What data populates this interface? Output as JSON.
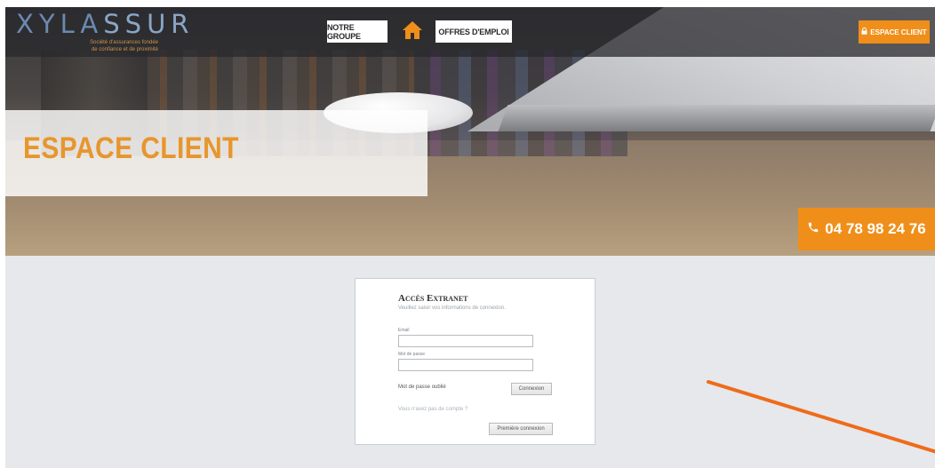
{
  "header": {
    "logo_prefix": "XYLA",
    "logo_suffix": "SSUR",
    "tagline_line1": "Société d'assurances fondée",
    "tagline_line2": "de confiance et de proximité",
    "nav": {
      "notre_groupe": "NOTRE GROUPE",
      "offres_emploi": "OFFRES D'EMPLOI"
    },
    "espace_client_btn": "ESPACE CLIENT"
  },
  "hero": {
    "title": "ESPACE CLIENT",
    "phone": "04 78 98 24 76"
  },
  "login": {
    "title": "Accès Extranet",
    "subtitle": "Veuillez saisir vos informations de connexion.",
    "email_label": "Email",
    "email_value": "",
    "password_label": "Mot de passe",
    "password_value": "",
    "forgot_password": "Mot de passe oublié",
    "connexion_btn": "Connexion",
    "no_account": "Vous n'avez pas de compte ?",
    "premiere_connexion_btn": "Première connexion"
  },
  "colors": {
    "accent": "#ef8f1a",
    "title": "#e7962d",
    "annotation_arrow": "#ef6b1a"
  },
  "icons": [
    "home-icon",
    "lock-icon",
    "phone-icon"
  ]
}
